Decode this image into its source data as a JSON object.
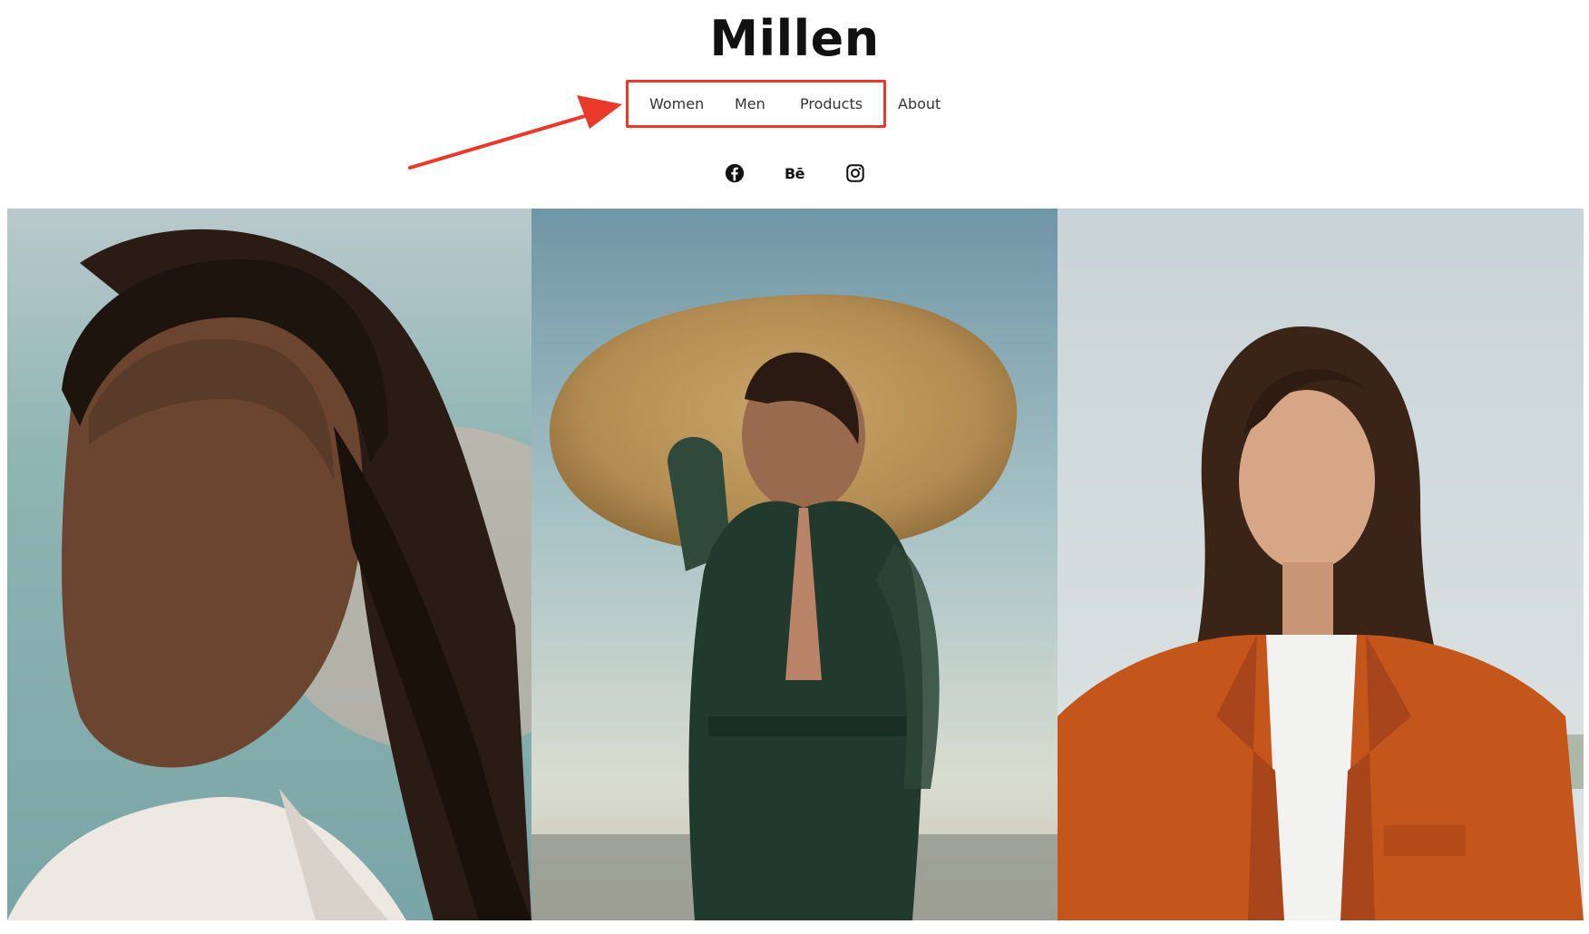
{
  "site": {
    "title": "Millen"
  },
  "nav": {
    "items": [
      {
        "label": "Women"
      },
      {
        "label": "Men"
      },
      {
        "label": "Products"
      },
      {
        "label": "About"
      }
    ]
  },
  "annotation": {
    "highlight_color": "#e8392a"
  },
  "social": {
    "icons": [
      "facebook-icon",
      "behance-icon",
      "instagram-icon"
    ],
    "behance_glyph": "Bē"
  },
  "gallery": {
    "photos": [
      {
        "subject": "woman-with-braids-white-shirt"
      },
      {
        "subject": "woman-in-wide-straw-hat-green-dress"
      },
      {
        "subject": "woman-in-orange-blazer"
      }
    ]
  }
}
